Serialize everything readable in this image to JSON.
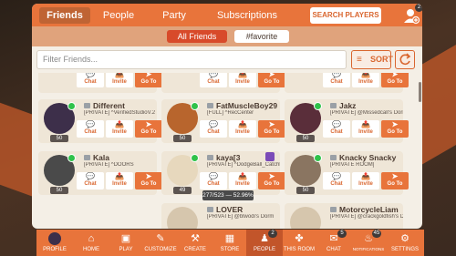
{
  "header": {
    "tabs": [
      {
        "label": "Friends"
      },
      {
        "label": "People"
      },
      {
        "label": "Party"
      },
      {
        "label": "Subscriptions"
      }
    ],
    "search_players_label": "SEARCH PLAYERS",
    "notification_count": "2"
  },
  "filter": {
    "all_friends_label": "All Friends",
    "favorite_label": "#favorite",
    "input_placeholder": "Filter Friends...",
    "sort_label": "SORT"
  },
  "buttons": {
    "chat": "Chat",
    "invite": "Invite",
    "goto": "Go To"
  },
  "friends": [
    {
      "name": "",
      "status": "",
      "level": ""
    },
    {
      "name": "",
      "status": "",
      "level": ""
    },
    {
      "name": "",
      "status": "",
      "level": ""
    },
    {
      "name": "Different",
      "status": "[PRIVATE] ^VerifiedStudioV.2",
      "level": "50"
    },
    {
      "name": "FatMuscleBoy29",
      "status": "[FULL] ^RecCenter",
      "level": "50"
    },
    {
      "name": "Jakz",
      "status": "[PRIVATE] @Missedcall's Dorm",
      "level": "50"
    },
    {
      "name": "Kala",
      "status": "[PRIVATE] ^DOORS",
      "level": "50"
    },
    {
      "name": "kaya[3",
      "status": "[PRIVATE] ^DodgeBall_CatchBattles",
      "level": "49"
    },
    {
      "name": "Knacky Snacky",
      "status": "[PRIVATE ROOM]",
      "level": "50"
    },
    {
      "name": "LOVER",
      "status": "[PRIVATE] @blwodi's Dorm",
      "level": ""
    },
    {
      "name": "MotorcycleLiam",
      "status": "[PRIVATE] @crackgoldfish's Dorm",
      "level": ""
    }
  ],
  "tooltip": "277/523 — 52.96%",
  "bottom_nav": [
    {
      "label": "PROFILE",
      "icon": "avatar-icon",
      "badge": ""
    },
    {
      "label": "HOME",
      "icon": "home-icon",
      "badge": ""
    },
    {
      "label": "PLAY",
      "icon": "gamepad-icon",
      "badge": ""
    },
    {
      "label": "CUSTOMIZE",
      "icon": "customize-icon",
      "badge": ""
    },
    {
      "label": "CREATE",
      "icon": "create-icon",
      "badge": ""
    },
    {
      "label": "STORE",
      "icon": "store-icon",
      "badge": ""
    },
    {
      "label": "PEOPLE",
      "icon": "people-icon",
      "badge": "2"
    },
    {
      "label": "THIS ROOM",
      "icon": "room-icon",
      "badge": ""
    },
    {
      "label": "CHAT",
      "icon": "chat-icon",
      "badge": "5"
    },
    {
      "label": "NOTIFICATIONS",
      "icon": "bell-icon",
      "badge": "45"
    },
    {
      "label": "SETTINGS",
      "icon": "gear-icon",
      "badge": ""
    }
  ],
  "colors": {
    "accent": "#e8743b",
    "panel": "#f4efe6",
    "online": "#2fc24a"
  }
}
